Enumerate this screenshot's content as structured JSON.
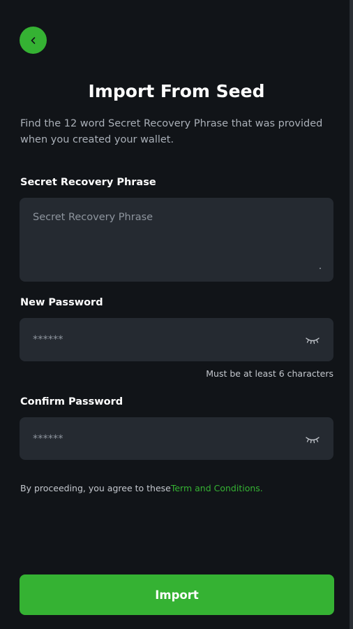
{
  "header": {
    "back_icon": "chevron-left-icon",
    "title": "Import From Seed",
    "subtitle": "Find the 12 word Secret Recovery Phrase that was provided when you created your wallet."
  },
  "form": {
    "seed": {
      "label": "Secret Recovery Phrase",
      "placeholder": "Secret Recovery Phrase",
      "value": ""
    },
    "new_password": {
      "label": "New Password",
      "placeholder": "******",
      "value": "",
      "toggle_icon": "eye-closed-icon",
      "hint": "Must be at least 6 characters"
    },
    "confirm_password": {
      "label": "Confirm Password",
      "placeholder": "******",
      "value": "",
      "toggle_icon": "eye-closed-icon"
    }
  },
  "terms": {
    "prefix": "By proceeding, you agree to these",
    "link": "Term and Conditions."
  },
  "actions": {
    "import_label": "Import"
  },
  "colors": {
    "background": "#111418",
    "field_background": "#252a31",
    "accent": "#35b233",
    "muted_text": "#aab0b8"
  }
}
